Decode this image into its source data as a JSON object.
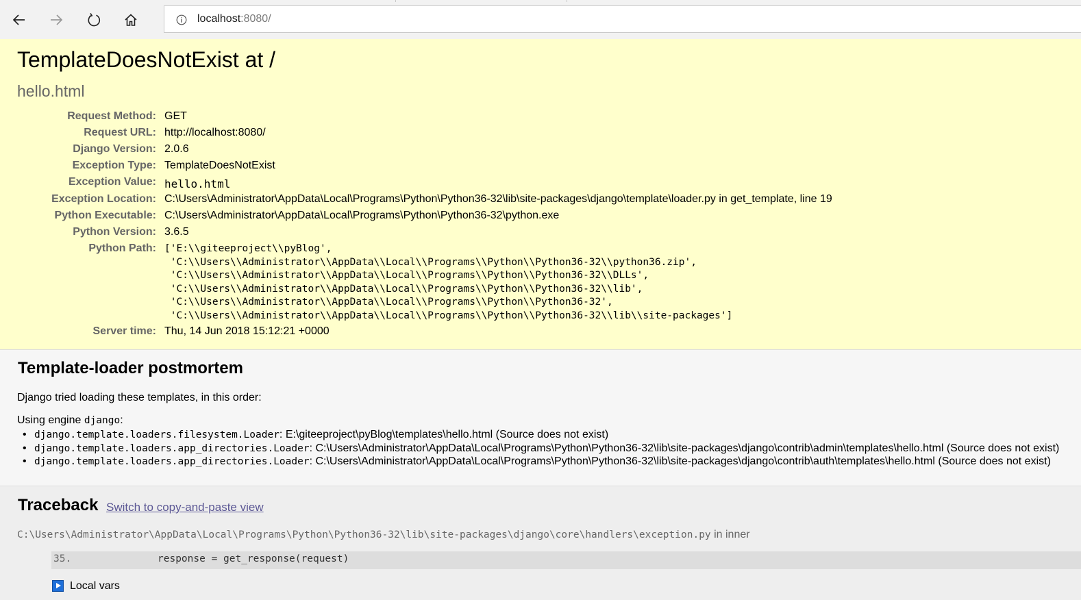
{
  "browser": {
    "url_host": "localhost",
    "url_rest": ":8080/"
  },
  "summary": {
    "title": "TemplateDoesNotExist at /",
    "exception_value": "hello.html",
    "rows": [
      {
        "key": "Request Method:",
        "value": "GET"
      },
      {
        "key": "Request URL:",
        "value": "http://localhost:8080/"
      },
      {
        "key": "Django Version:",
        "value": "2.0.6"
      },
      {
        "key": "Exception Type:",
        "value": "TemplateDoesNotExist"
      },
      {
        "key": "Exception Value:",
        "value": "hello.html"
      },
      {
        "key": "Exception Location:",
        "value": "C:\\Users\\Administrator\\AppData\\Local\\Programs\\Python\\Python36-32\\lib\\site-packages\\django\\template\\loader.py in get_template, line 19"
      },
      {
        "key": "Python Executable:",
        "value": "C:\\Users\\Administrator\\AppData\\Local\\Programs\\Python\\Python36-32\\python.exe"
      },
      {
        "key": "Python Version:",
        "value": "3.6.5"
      },
      {
        "key": "Python Path:",
        "value": ""
      },
      {
        "key": "Server time:",
        "value": "Thu, 14 Jun 2018 15:12:21 +0000"
      }
    ],
    "python_path": [
      "['E:\\\\giteeproject\\\\pyBlog',",
      " 'C:\\\\Users\\\\Administrator\\\\AppData\\\\Local\\\\Programs\\\\Python\\\\Python36-32\\\\python36.zip',",
      " 'C:\\\\Users\\\\Administrator\\\\AppData\\\\Local\\\\Programs\\\\Python\\\\Python36-32\\\\DLLs',",
      " 'C:\\\\Users\\\\Administrator\\\\AppData\\\\Local\\\\Programs\\\\Python\\\\Python36-32\\\\lib',",
      " 'C:\\\\Users\\\\Administrator\\\\AppData\\\\Local\\\\Programs\\\\Python\\\\Python36-32',",
      " 'C:\\\\Users\\\\Administrator\\\\AppData\\\\Local\\\\Programs\\\\Python\\\\Python36-32\\\\lib\\\\site-packages']"
    ]
  },
  "postmortem": {
    "title": "Template-loader postmortem",
    "intro": "Django tried loading these templates, in this order:",
    "engine_prefix": "Using engine ",
    "engine_name": "django",
    "engine_suffix": ":",
    "items": [
      {
        "loader": "django.template.loaders.filesystem.Loader",
        "detail": ": E:\\giteeproject\\pyBlog\\templates\\hello.html (Source does not exist)"
      },
      {
        "loader": "django.template.loaders.app_directories.Loader",
        "detail": ": C:\\Users\\Administrator\\AppData\\Local\\Programs\\Python\\Python36-32\\lib\\site-packages\\django\\contrib\\admin\\templates\\hello.html (Source does not exist)"
      },
      {
        "loader": "django.template.loaders.app_directories.Loader",
        "detail": ": C:\\Users\\Administrator\\AppData\\Local\\Programs\\Python\\Python36-32\\lib\\site-packages\\django\\contrib\\auth\\templates\\hello.html (Source does not exist)"
      }
    ]
  },
  "traceback": {
    "title": "Traceback",
    "switch_link": "Switch to copy-and-paste view",
    "frame_path": "C:\\Users\\Administrator\\AppData\\Local\\Programs\\Python\\Python36-32\\lib\\site-packages\\django\\core\\handlers\\exception.py",
    "frame_in": " in ",
    "frame_func": "inner",
    "line_no": "35.",
    "line_code": "response = get_response(request)",
    "local_vars": "Local vars"
  }
}
